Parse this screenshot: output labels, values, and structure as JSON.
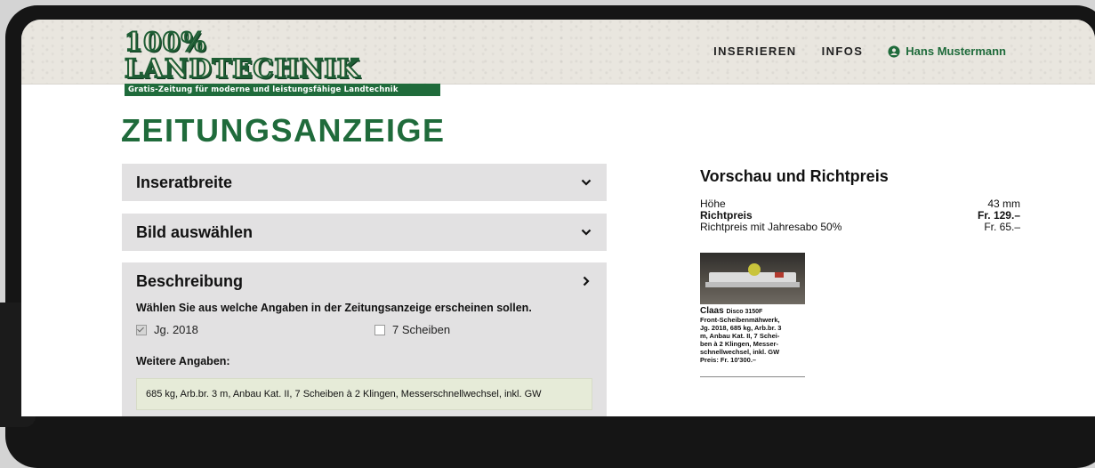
{
  "header": {
    "logo_title": "100% LANDTECHNIK",
    "logo_tagline": "Gratis-Zeitung für moderne und leistungsfähige Landtechnik",
    "nav": [
      "INSERIEREN",
      "INFOS"
    ],
    "user_name": "Hans Mustermann"
  },
  "page_title": "ZEITUNGSANZEIGE",
  "accordion": [
    {
      "label": "Inseratbreite",
      "icon": "chevron-down-icon"
    },
    {
      "label": "Bild auswählen",
      "icon": "chevron-down-icon"
    },
    {
      "label": "Beschreibung",
      "icon": "chevron-right-icon"
    }
  ],
  "description": {
    "instruction": "Wählen Sie aus welche Angaben in der Zeitungsanzeige erscheinen sollen.",
    "options": [
      {
        "label": "Jg. 2018",
        "checked": true
      },
      {
        "label": "7 Scheiben",
        "checked": false
      }
    ],
    "more_label": "Weitere Angaben:",
    "more_value": "685 kg, Arb.br. 3 m, Anbau Kat. II, 7 Scheiben à 2 Klingen, Messerschnellwechsel, inkl. GW"
  },
  "preview": {
    "title": "Vorschau und Richtpreis",
    "rows": [
      {
        "label": "Höhe",
        "value": "43 mm"
      },
      {
        "label": "Richtpreis",
        "value": "Fr. 129.–"
      },
      {
        "label": "Richtpreis mit Jahresabo 50%",
        "value": "Fr. 65.–"
      }
    ],
    "ad": {
      "brand": "Claas",
      "model": "Disco 3150F",
      "lines": [
        "Front-Scheibenmähwerk,",
        "Jg. 2018, 685 kg, Arb.br. 3",
        "m, Anbau Kat. II, 7 Schei-",
        "ben à 2 Klingen, Messer-",
        "schnellwechsel, inkl. GW",
        "Preis: Fr. 10'300.–"
      ]
    }
  },
  "colors": {
    "brand_green": "#1f6b3b",
    "field_bg": "#e6ebd8",
    "panel_bg": "#e2e1e2"
  }
}
